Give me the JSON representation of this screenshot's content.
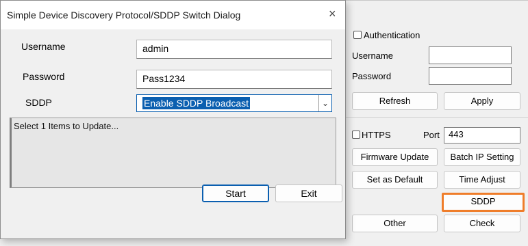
{
  "background": {
    "authentication_label": "Authentication",
    "username_label": "Username",
    "password_label": "Password",
    "username_value": "",
    "password_value": "",
    "refresh_label": "Refresh",
    "apply_label": "Apply",
    "https_label": "HTTPS",
    "port_label": "Port",
    "port_value": "443",
    "firmware_update_label": "Firmware Update",
    "batch_ip_label": "Batch IP Setting",
    "set_default_label": "Set as Default",
    "time_adjust_label": "Time Adjust",
    "sddp_label": "SDDP",
    "other_label": "Other",
    "check_label": "Check",
    "highlight_color": "#ef7d2a"
  },
  "dialog": {
    "title": "Simple Device Discovery Protocol/SDDP Switch Dialog",
    "close_icon": "×",
    "username_label": "Username",
    "username_value": "admin",
    "password_label": "Password",
    "password_value": "Pass1234",
    "sddp_label": "SDDP",
    "sddp_selected": "Enable SDDP Broadcast",
    "chevron_icon": "⌄",
    "status_text": "Select 1 Items to Update...",
    "start_label": "Start",
    "exit_label": "Exit",
    "accent_color": "#0b5fb0"
  }
}
